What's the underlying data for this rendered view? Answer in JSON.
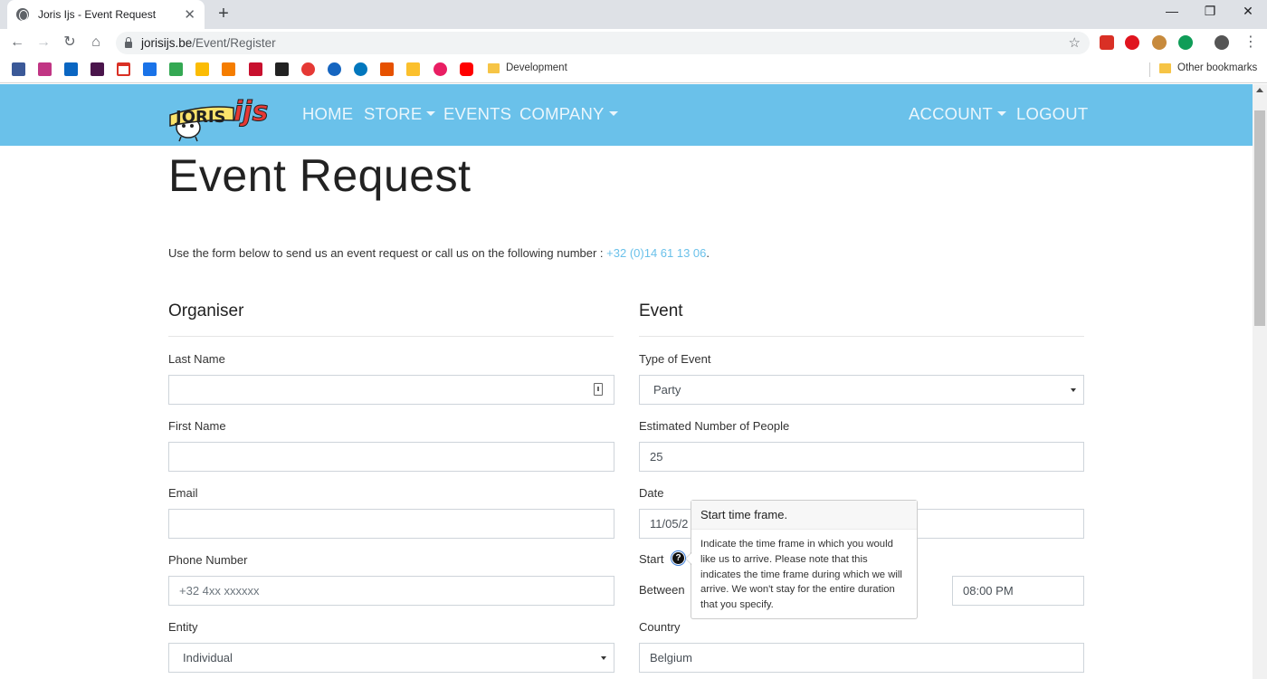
{
  "browser": {
    "tab_title": "Joris Ijs - Event Request",
    "tab_close": "✕",
    "new_tab": "+",
    "url_host": "jorisijs.be",
    "url_path": "/Event/Register",
    "window_controls": {
      "minimize": "—",
      "restore": "❐",
      "close": "✕"
    },
    "bookmarks": {
      "development": "Development",
      "other": "Other bookmarks"
    }
  },
  "site_nav": {
    "logo_text": "JORISIJS",
    "home": "HOME",
    "store": "STORE",
    "events": "EVENTS",
    "company": "COMPANY",
    "account": "ACCOUNT",
    "logout": "LOGOUT"
  },
  "page": {
    "title": "Event Request",
    "intro_text": "Use the form below to send us an event request or call us on the following number : ",
    "phone_link": "+32 (0)14 61 13 06",
    "intro_end": "."
  },
  "organiser": {
    "title": "Organiser",
    "last_name_label": "Last Name",
    "last_name_value": "",
    "first_name_label": "First Name",
    "first_name_value": "",
    "email_label": "Email",
    "email_value": "",
    "phone_label": "Phone Number",
    "phone_placeholder": "+32 4xx xxxxxx",
    "entity_label": "Entity",
    "entity_value": "Individual"
  },
  "event": {
    "title": "Event",
    "type_label": "Type of Event",
    "type_value": "Party",
    "people_label": "Estimated Number of People",
    "people_value": "25",
    "date_label": "Date",
    "date_value": "11/05/2",
    "start_label": "Start",
    "between_label": "Between",
    "end_time_value": "08:00 PM",
    "country_label": "Country",
    "country_value": "Belgium"
  },
  "popover": {
    "title": "Start time frame.",
    "body": "Indicate the time frame in which you would like us to arrive. Please note that this indicates the time frame during which we will arrive. We won't stay for the entire duration that you specify."
  },
  "colors": {
    "brand_blue": "#6ac1ea",
    "link_blue": "#6ac1ea"
  }
}
